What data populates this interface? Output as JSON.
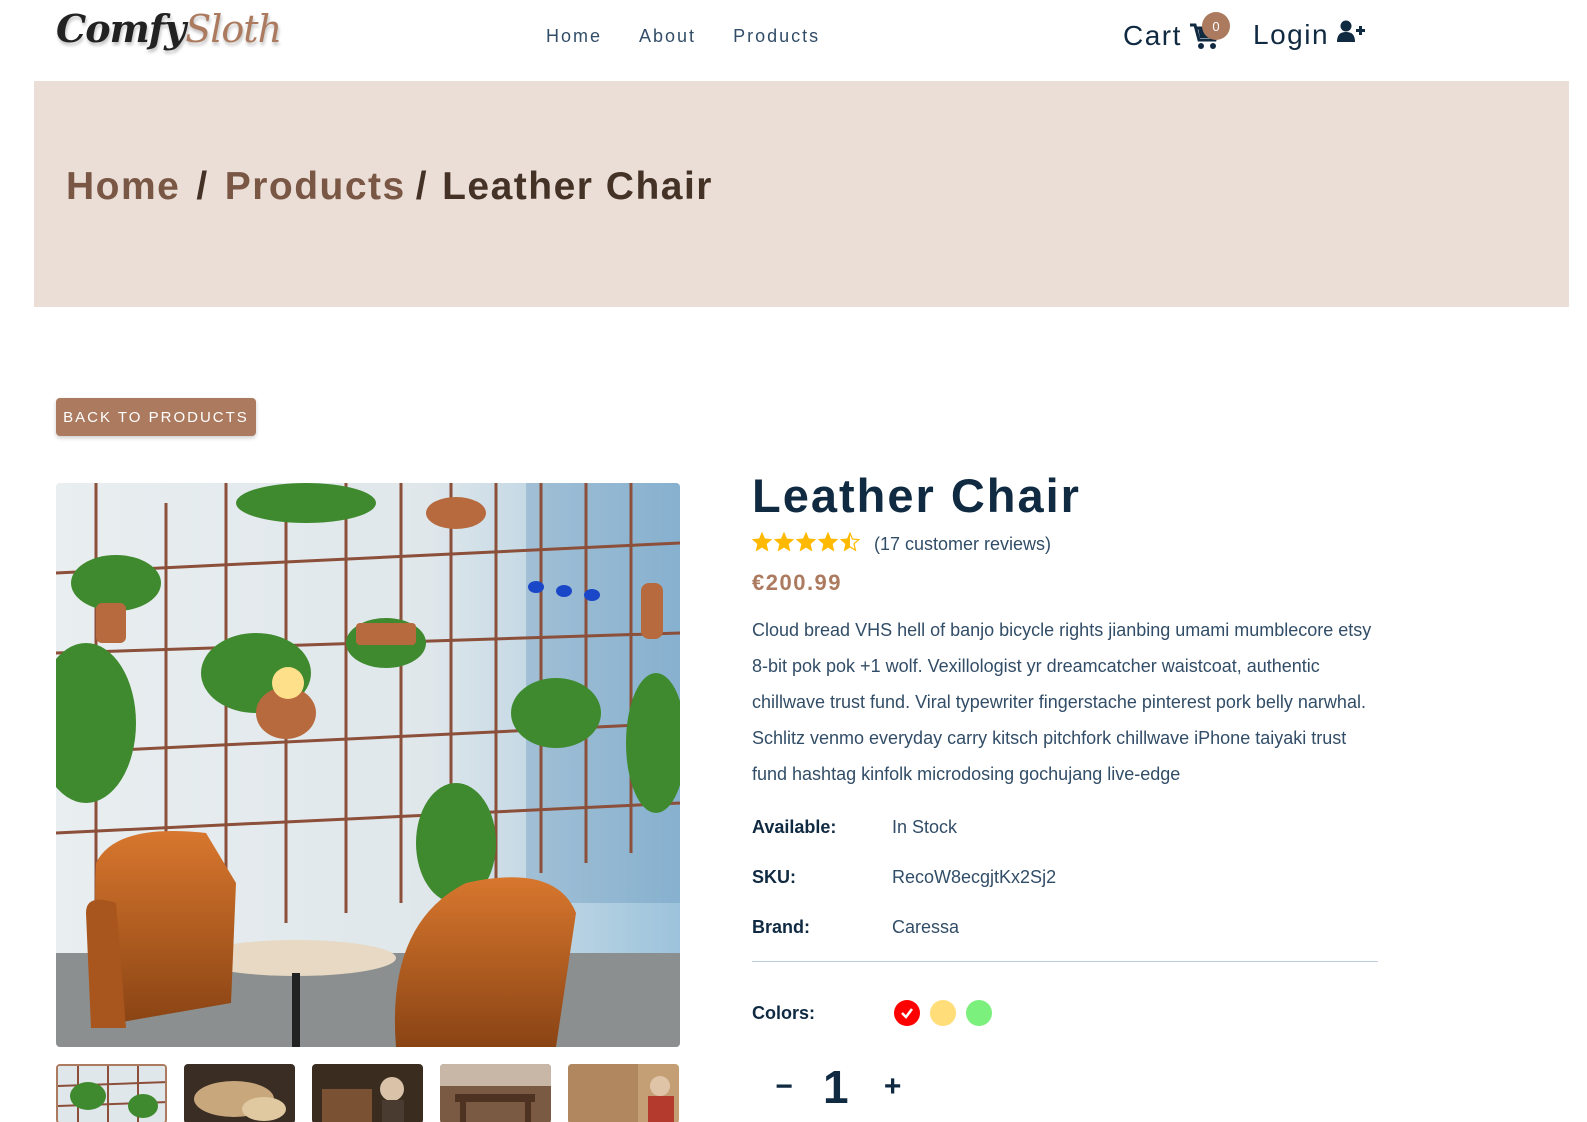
{
  "brand": {
    "part1": "Comfy",
    "part2": "Sloth"
  },
  "nav": {
    "links": [
      "Home",
      "About",
      "Products"
    ]
  },
  "cart": {
    "label": "Cart",
    "count": "0"
  },
  "login": {
    "label": "Login"
  },
  "breadcrumb": {
    "home": "Home",
    "products": "Products",
    "current": "Leather Chair",
    "separator": "/"
  },
  "back_button": "BACK TO PRODUCTS",
  "product": {
    "name": "Leather Chair",
    "rating": 4.5,
    "reviews": "(17 customer reviews)",
    "price": "€200.99",
    "description": "Cloud bread VHS hell of banjo bicycle rights jianbing umami mumblecore etsy 8-bit pok pok +1 wolf. Vexillologist yr dreamcatcher waistcoat, authentic chillwave trust fund. Viral typewriter fingerstache pinterest pork belly narwhal. Schlitz venmo everyday carry kitsch pitchfork chillwave iPhone taiyaki trust fund hashtag kinfolk microdosing gochujang live-edge",
    "available_label": "Available:",
    "available": "In Stock",
    "sku_label": "SKU:",
    "sku": "RecoW8ecgjtKx2Sj2",
    "brand_label": "Brand:",
    "brand": "Caressa",
    "colors_label": "Colors:",
    "colors": [
      "#ff0000",
      "#ffde7a",
      "#7cf07c"
    ],
    "selected_color": "#ff0000",
    "quantity": "1",
    "decrease": "−",
    "increase": "+"
  },
  "theme": {
    "accent": "#ab7a5f",
    "hero_bg": "#eaded7",
    "star": "#ffb900"
  }
}
